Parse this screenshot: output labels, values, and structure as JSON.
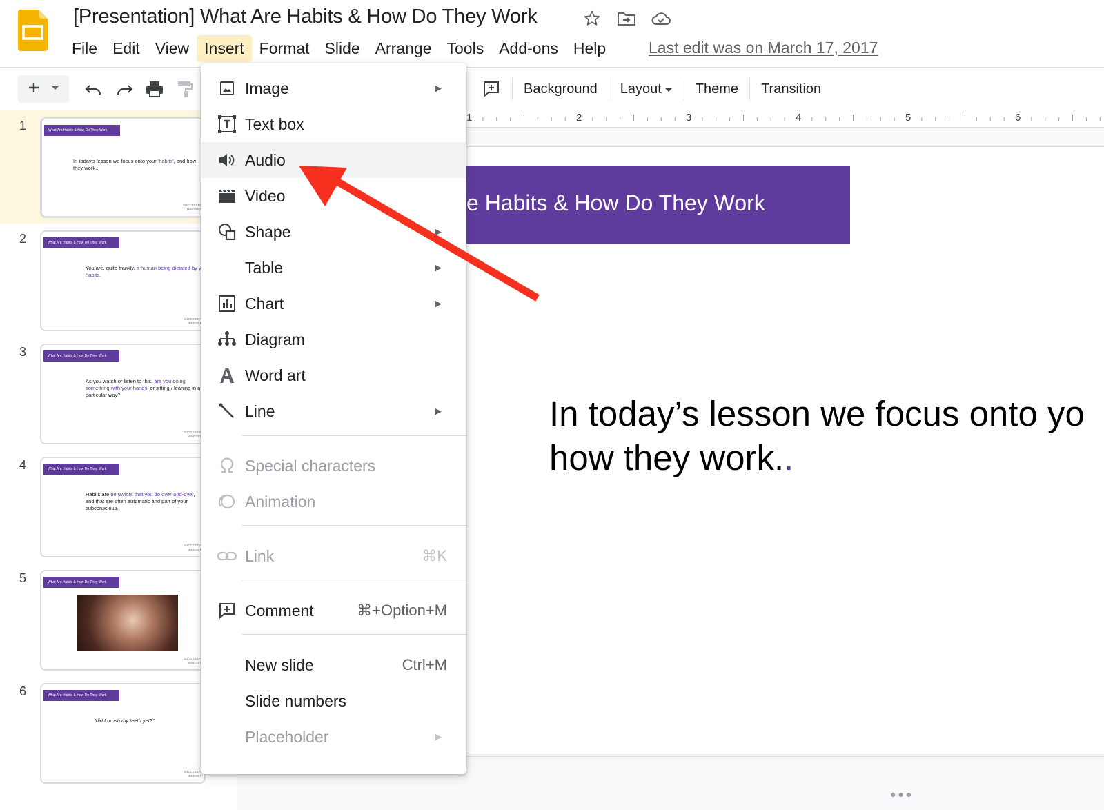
{
  "header": {
    "doc_title": "[Presentation] What Are Habits & How Do They Work",
    "title_icons": [
      "star-icon",
      "move-to-folder-icon",
      "cloud-saved-icon"
    ],
    "menus": [
      "File",
      "Edit",
      "View",
      "Insert",
      "Format",
      "Slide",
      "Arrange",
      "Tools",
      "Add-ons",
      "Help"
    ],
    "active_menu": "Insert",
    "last_edit": "Last edit was on March 17, 2017"
  },
  "toolbar": {
    "left_icons": [
      "add-icon",
      "dropdown-arrow-icon",
      "undo-icon",
      "redo-icon",
      "print-icon",
      "paint-format-icon"
    ],
    "right": {
      "comment_icon": "add-comment-icon",
      "background": "Background",
      "layout": "Layout",
      "theme": "Theme",
      "transition": "Transition"
    }
  },
  "ruler": {
    "numbers": [
      "1",
      "2",
      "3",
      "4",
      "5",
      "6"
    ]
  },
  "filmstrip": {
    "selected_index": 1,
    "slides": [
      {
        "number": "1",
        "bar": "What Are Habits & How Do They Work",
        "text_plain_1": "In today's lesson we focus onto your ",
        "text_highlight_1": "'habits'",
        "text_plain_2": ", and how they work..",
        "logo": "SUCCESSFUL MINDSET"
      },
      {
        "number": "2",
        "bar": "What Are Habits & How Do They Work",
        "text_plain_1": "You are, quite frankly, ",
        "text_highlight_1": "a human being dictated by your habits",
        "text_plain_2": ".",
        "logo": "SUCCESSFUL MINDSET"
      },
      {
        "number": "3",
        "bar": "What Are Habits & How Do They Work",
        "text_plain_1": "As you watch or listen to this, ",
        "text_highlight_1": "are you doing something with your hands",
        "text_plain_2": ", or sitting / leaning in a particular way?",
        "logo": "SUCCESSFUL MINDSET"
      },
      {
        "number": "4",
        "bar": "What Are Habits & How Do They Work",
        "text_plain_1": "Habits are ",
        "text_highlight_1": "behaviors that you do over-and-over",
        "text_plain_2": ", and that are often automatic and part of your subconscious.",
        "logo": "SUCCESSFUL MINDSET"
      },
      {
        "number": "5",
        "bar": "What Are Habits & How Do They Work",
        "logo": "SUCCESSFUL MINDSET"
      },
      {
        "number": "6",
        "bar": "What Are Habits & How Do They Work",
        "quote": "\"did I brush my teeth yet?\"",
        "logo": "SUCCESSFUL MINDSET"
      }
    ]
  },
  "slide": {
    "banner_text": "e Habits & How Do They Work",
    "body_line1": "In today’s lesson we focus onto yo",
    "body_line2": "how they work.",
    "body_line2_dot": "."
  },
  "insert_menu": {
    "hovered": "Audio",
    "items": [
      {
        "label": "Image",
        "icon": "image-icon",
        "submenu": true,
        "disabled": false
      },
      {
        "label": "Text box",
        "icon": "text-box-icon",
        "submenu": false,
        "disabled": false
      },
      {
        "label": "Audio",
        "icon": "audio-icon",
        "submenu": false,
        "disabled": false
      },
      {
        "label": "Video",
        "icon": "video-icon",
        "submenu": false,
        "disabled": false
      },
      {
        "label": "Shape",
        "icon": "shape-icon",
        "submenu": true,
        "disabled": false
      },
      {
        "label": "Table",
        "icon": "",
        "submenu": true,
        "disabled": false
      },
      {
        "label": "Chart",
        "icon": "chart-icon",
        "submenu": true,
        "disabled": false
      },
      {
        "label": "Diagram",
        "icon": "diagram-icon",
        "submenu": false,
        "disabled": false
      },
      {
        "label": "Word art",
        "icon": "word-art-icon",
        "submenu": false,
        "disabled": false
      },
      {
        "label": "Line",
        "icon": "line-icon",
        "submenu": true,
        "disabled": false
      },
      {
        "label": "Special characters",
        "icon": "omega-icon",
        "submenu": false,
        "disabled": true
      },
      {
        "label": "Animation",
        "icon": "animation-icon",
        "submenu": false,
        "disabled": true
      },
      {
        "label": "Link",
        "icon": "link-icon",
        "shortcut": "⌘K",
        "submenu": false,
        "disabled": true
      },
      {
        "label": "Comment",
        "icon": "comment-icon",
        "shortcut": "⌘+Option+M",
        "submenu": false,
        "disabled": false
      },
      {
        "label": "New slide",
        "icon": "",
        "shortcut": "Ctrl+M",
        "submenu": false,
        "disabled": false
      },
      {
        "label": "Slide numbers",
        "icon": "",
        "submenu": false,
        "disabled": false
      },
      {
        "label": "Placeholder",
        "icon": "",
        "submenu": true,
        "disabled": true
      }
    ]
  },
  "annotation": {
    "arrow_color": "#f5301f",
    "target": "Audio"
  },
  "colors": {
    "accent_purple": "#5e3b9c",
    "active_menu_bg": "#feefc3",
    "selected_slide_bg": "#fef7e0",
    "app_logo_yellow": "#f4b400"
  }
}
